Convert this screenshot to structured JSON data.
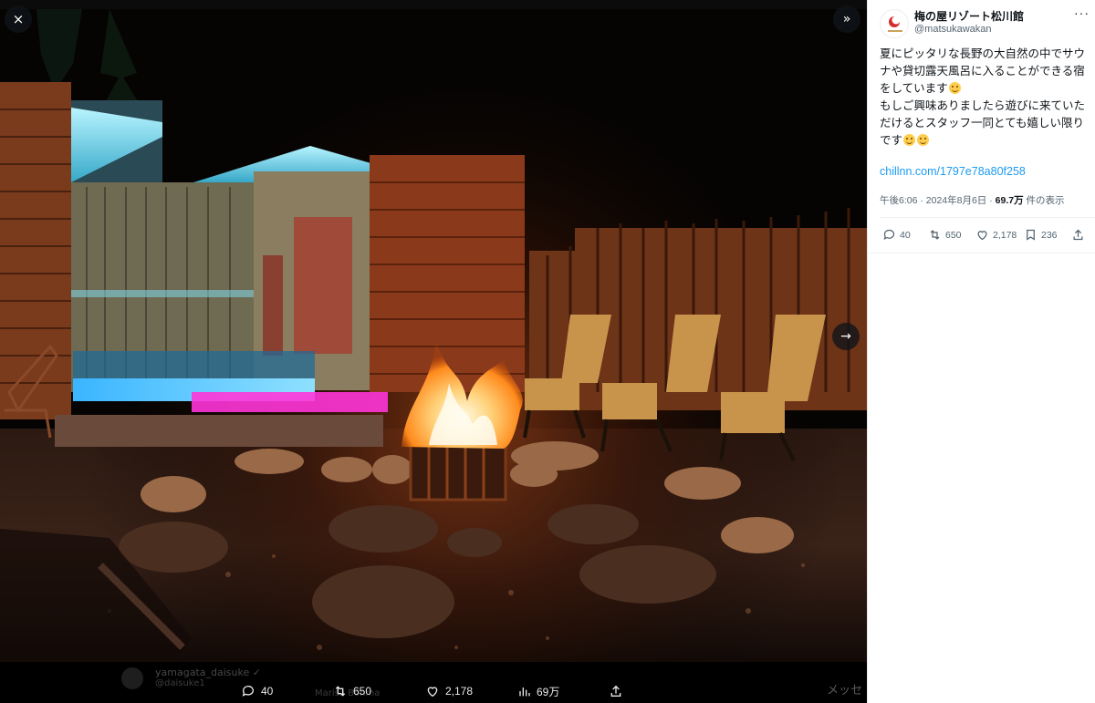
{
  "viewer": {
    "close_icon": "×",
    "collapse_icon": "»",
    "next_icon": "→",
    "actions": {
      "reply_count": "40",
      "retweet_count": "650",
      "like_count": "2,178",
      "views_count": "69万"
    }
  },
  "background_ghost": {
    "name": "yamagata_daisuke ✓",
    "handle": "@daisuke1",
    "mid_text": "Marisa Bonma",
    "right_text": "メッセ"
  },
  "tweet": {
    "display_name": "梅の屋リゾート松川館",
    "handle": "@matsukawakan",
    "more_label": "···",
    "lines": [
      "夏にピッタリな長野の大自然の中でサウナや貸切露天風呂に入ることができる宿をしています",
      "もしご興味ありましたら遊びに来ていただけるとスタッフ一同とても嬉しい限りです"
    ],
    "link_text": "chillnn.com/1797e78a80f258",
    "timestamp": "午後6:06 · 2024年8月6日 · ",
    "views_value": "69.7万",
    "views_suffix": " 件の表示",
    "stats": {
      "replies": "40",
      "retweets": "650",
      "likes": "2,178",
      "bookmarks": "236"
    }
  },
  "icons": [
    "close-icon",
    "collapse-icon",
    "next-arrow-icon",
    "reply-icon",
    "retweet-icon",
    "like-icon",
    "views-icon",
    "share-icon",
    "bookmark-icon",
    "more-icon"
  ],
  "colors": {
    "link": "#1d9bf0",
    "secondary_text": "#536471",
    "primary_text": "#0f1419"
  }
}
